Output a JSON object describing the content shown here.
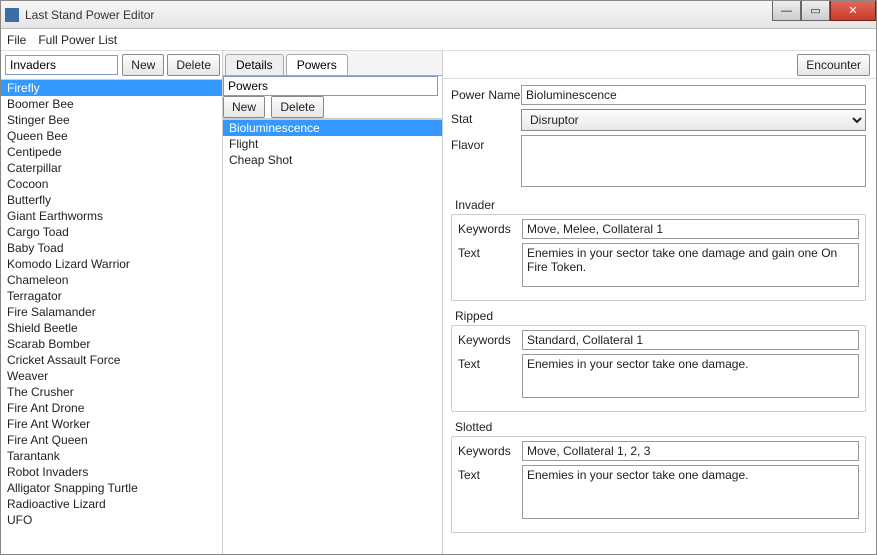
{
  "window": {
    "title": "Last Stand Power Editor"
  },
  "menu": {
    "file": "File",
    "fullPowerList": "Full Power List"
  },
  "left": {
    "label": "Invaders",
    "new": "New",
    "del": "Delete",
    "selected_index": 0,
    "items": [
      "Firefly",
      "Boomer Bee",
      "Stinger Bee",
      "Queen Bee",
      "Centipede",
      "Caterpillar",
      "Cocoon",
      "Butterfly",
      "Giant Earthworms",
      "Cargo Toad",
      "Baby Toad",
      "Komodo Lizard Warrior",
      "Chameleon",
      "Terragator",
      "Fire Salamander",
      "Shield Beetle",
      "Scarab Bomber",
      "Cricket Assault Force",
      "Weaver",
      "The Crusher",
      "Fire Ant Drone",
      "Fire Ant Worker",
      "Fire Ant Queen",
      "Tarantank",
      "Robot Invaders",
      "Alligator Snapping Turtle",
      "Radioactive Lizard",
      "UFO"
    ]
  },
  "tabs": {
    "details": "Details",
    "powers": "Powers",
    "active": "powers"
  },
  "mid": {
    "label": "Powers",
    "new": "New",
    "del": "Delete",
    "selected_index": 0,
    "items": [
      "Bioluminescence",
      "Flight",
      "Cheap Shot"
    ]
  },
  "right": {
    "encounter": "Encounter",
    "labels": {
      "powerName": "Power Name",
      "stat": "Stat",
      "flavor": "Flavor",
      "keywords": "Keywords",
      "text": "Text",
      "invader": "Invader",
      "ripped": "Ripped",
      "slotted": "Slotted"
    },
    "power": {
      "name": "Bioluminescence",
      "stat": "Disruptor",
      "flavor": "",
      "invader": {
        "keywords": "Move, Melee, Collateral 1",
        "text": "Enemies in your sector take one damage and gain one On Fire Token."
      },
      "ripped": {
        "keywords": "Standard, Collateral 1",
        "text": "Enemies in your sector take one damage."
      },
      "slotted": {
        "keywords": "Move, Collateral 1, 2, 3",
        "text": "Enemies in your sector take one damage."
      }
    }
  }
}
